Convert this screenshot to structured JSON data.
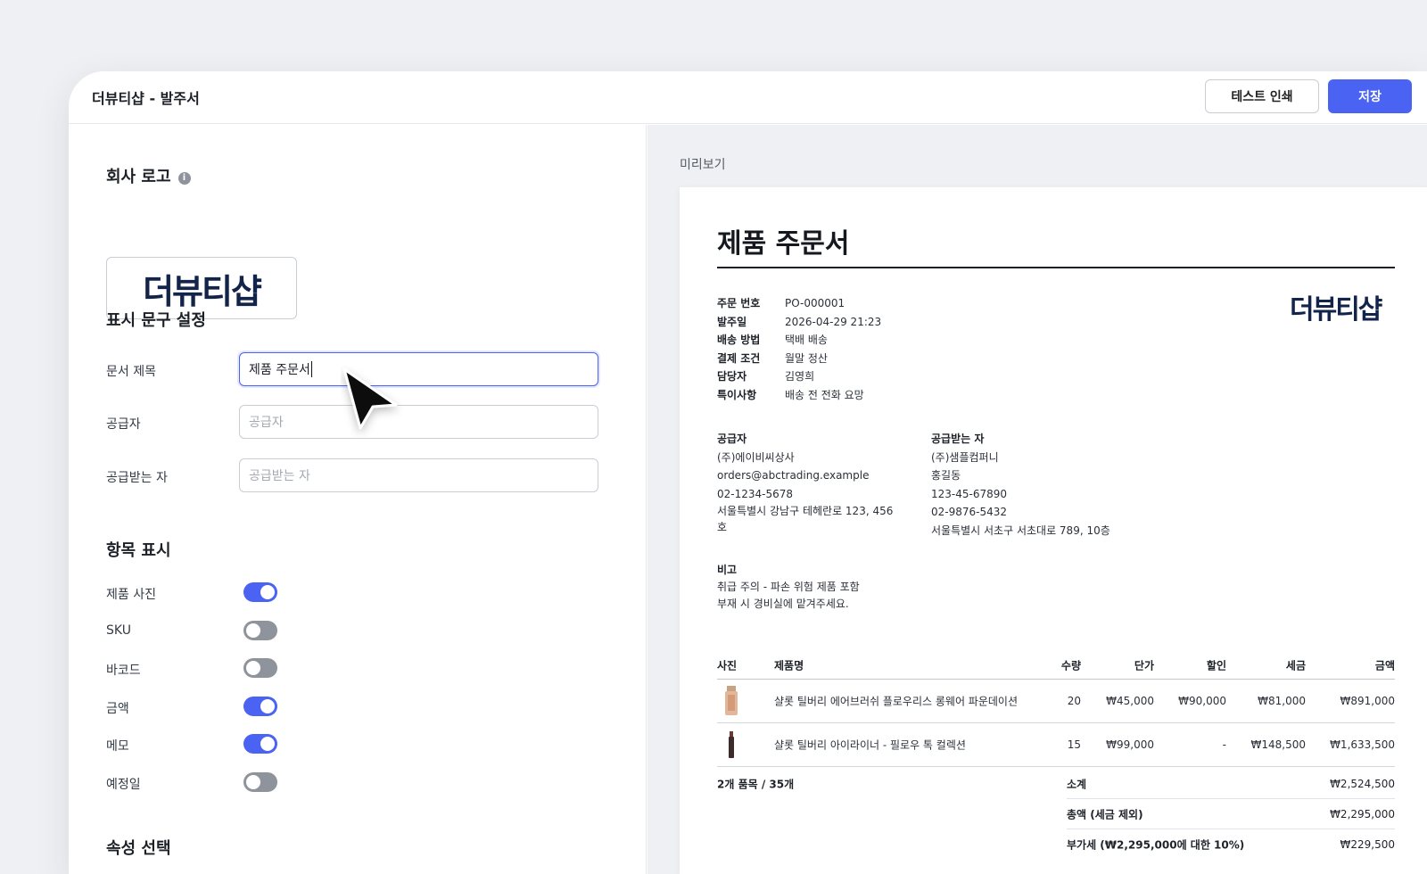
{
  "window": {
    "title": "더뷰티샵 - 발주서"
  },
  "toolbar": {
    "test_print_label": "테스트 인쇄",
    "save_label": "저장"
  },
  "settings": {
    "logo_section": "회사 로고",
    "logo_text": "더뷰티샵",
    "text_section": "표시 문구 설정",
    "fields": {
      "title_label": "문서 제목",
      "title_value": "제품 주문서",
      "supplier_label": "공급자",
      "supplier_placeholder": "공급자",
      "receiver_label": "공급받는 자",
      "receiver_placeholder": "공급받는 자"
    },
    "items_section": "항목 표시",
    "toggles": [
      {
        "label": "제품 사진",
        "on": true
      },
      {
        "label": "SKU",
        "on": false
      },
      {
        "label": "바코드",
        "on": false
      },
      {
        "label": "금액",
        "on": true
      },
      {
        "label": "메모",
        "on": true
      },
      {
        "label": "예정일",
        "on": false
      }
    ],
    "attributes_section": "속성 선택"
  },
  "preview": {
    "label": "미리보기",
    "doc_title": "제품 주문서",
    "logo_text": "더뷰티샵",
    "meta": [
      {
        "k": "주문 번호",
        "v": "PO-000001"
      },
      {
        "k": "발주일",
        "v": "2026-04-29 21:23"
      },
      {
        "k": "배송 방법",
        "v": "택배 배송"
      },
      {
        "k": "결제 조건",
        "v": "월말 정산"
      },
      {
        "k": "담당자",
        "v": "김영희"
      },
      {
        "k": "특이사항",
        "v": "배송 전 전화 요망"
      }
    ],
    "supplier": {
      "heading": "공급자",
      "lines": [
        "(주)에이비씨상사",
        "orders@abctrading.example",
        "02-1234-5678",
        "서울특별시 강남구 테헤란로 123, 456호"
      ]
    },
    "receiver": {
      "heading": "공급받는 자",
      "lines": [
        "(주)샘플컴퍼니",
        "홍길동",
        "123-45-67890",
        "02-9876-5432",
        "서울특별시 서초구 서초대로 789, 10층"
      ]
    },
    "note": {
      "heading": "비고",
      "lines": [
        "취급 주의 - 파손 위험 제품 포함",
        "부재 시 경비실에 맡겨주세요."
      ]
    },
    "table": {
      "headers": {
        "photo": "사진",
        "name": "제품명",
        "qty": "수량",
        "price": "단가",
        "discount": "할인",
        "tax": "세금",
        "amount": "금액"
      },
      "rows": [
        {
          "name": "샬롯 틸버리 에어브러쉬 플로우리스 롱웨어 파운데이션",
          "qty": "20",
          "price": "₩45,000",
          "discount": "₩90,000",
          "tax": "₩81,000",
          "amount": "₩891,000"
        },
        {
          "name": "샬롯 틸버리 아이라이너 - 필로우 톡 컬렉션",
          "qty": "15",
          "price": "₩99,000",
          "discount": "-",
          "tax": "₩148,500",
          "amount": "₩1,633,500"
        }
      ]
    },
    "summary": {
      "count": "2개 품목 / 35개",
      "subtotal_label": "소계",
      "subtotal": "₩2,524,500",
      "total_label": "총액 (세금 제외)",
      "total": "₩2,295,000",
      "vat_label": "부가세 (₩2,295,000에 대한 10%)",
      "vat": "₩229,500"
    }
  }
}
